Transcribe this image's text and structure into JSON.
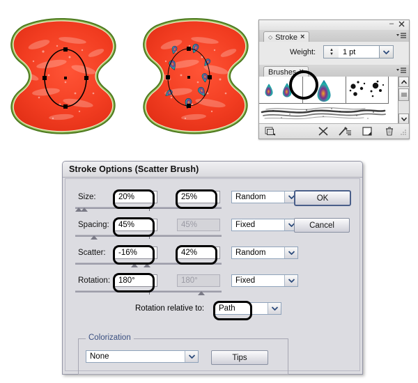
{
  "artwork": {
    "left_label": "watermelon-with-ellipse-path",
    "right_label": "watermelon-with-scatter-brush-applied"
  },
  "panels": {
    "stroke": {
      "tab_label": "Stroke",
      "close_glyph": "×",
      "diamond_glyph": "◇",
      "weight_label": "Weight:",
      "weight_value": "1 pt",
      "spinner_up": "▲",
      "spinner_down": "▼",
      "dropdown_glyph": "∨"
    },
    "brushes": {
      "tab_label": "Brushes",
      "close_glyph": "×",
      "scroll_up_glyph": "∧",
      "scroll_down_glyph": "∨",
      "swatches": [
        {
          "name": "scatter-brush-small-teardrop"
        },
        {
          "name": "scatter-brush-medium-teardrop"
        },
        {
          "name": "scatter-brush-selected-teardrop"
        },
        {
          "name": "scatter-brush-ink-splatter"
        },
        {
          "name": "scatter-brush-ink-drops"
        }
      ],
      "art_brush_name": "art-brush-charcoal-stroke",
      "toolbar": [
        {
          "name": "brush-libraries-menu-icon"
        },
        {
          "name": "remove-brush-stroke-icon"
        },
        {
          "name": "options-of-selected-object-icon"
        },
        {
          "name": "new-brush-icon"
        },
        {
          "name": "delete-brush-icon"
        },
        {
          "name": "resize-grip-icon"
        }
      ]
    },
    "window": {
      "minimize_glyph": "–",
      "close_glyph": "×"
    }
  },
  "dialog": {
    "title": "Stroke Options (Scatter Brush)",
    "rows": [
      {
        "key": "size",
        "label": "Size:",
        "value1": "20%",
        "value2": "25%",
        "value2_enabled": true,
        "mode": "Random",
        "highlight1": true,
        "highlight2": true
      },
      {
        "key": "spacing",
        "label": "Spacing:",
        "value1": "45%",
        "value2": "45%",
        "value2_enabled": false,
        "mode": "Fixed",
        "highlight1": true,
        "highlight2": false
      },
      {
        "key": "scatter",
        "label": "Scatter:",
        "value1": "-16%",
        "value2": "42%",
        "value2_enabled": true,
        "mode": "Random",
        "highlight1": true,
        "highlight2": true
      },
      {
        "key": "rotation",
        "label": "Rotation:",
        "value1": "180°",
        "value2": "180°",
        "value2_enabled": false,
        "mode": "Fixed",
        "highlight1": true,
        "highlight2": false
      }
    ],
    "rotation_relative": {
      "label": "Rotation relative to:",
      "value": "Path"
    },
    "colorization": {
      "legend": "Colorization",
      "method_value": "None",
      "tips_label": "Tips"
    },
    "buttons": {
      "ok": "OK",
      "cancel": "Cancel"
    },
    "dropdown_glyph": "∨"
  },
  "colors": {
    "dialog_face": "#dcdce1",
    "panel_face": "#e6e6e6",
    "legend_blue": "#3a4f80",
    "default_button_border": "#4a5f8a",
    "watermelon_flesh": "#f23d21",
    "watermelon_rind_dark": "#4d7a1f",
    "watermelon_rind_light": "#e6efc8",
    "brush_teal": "#1fb5a8",
    "brush_purple": "#5b2d82",
    "brush_orange": "#f5a623",
    "annotation": "#000000"
  }
}
